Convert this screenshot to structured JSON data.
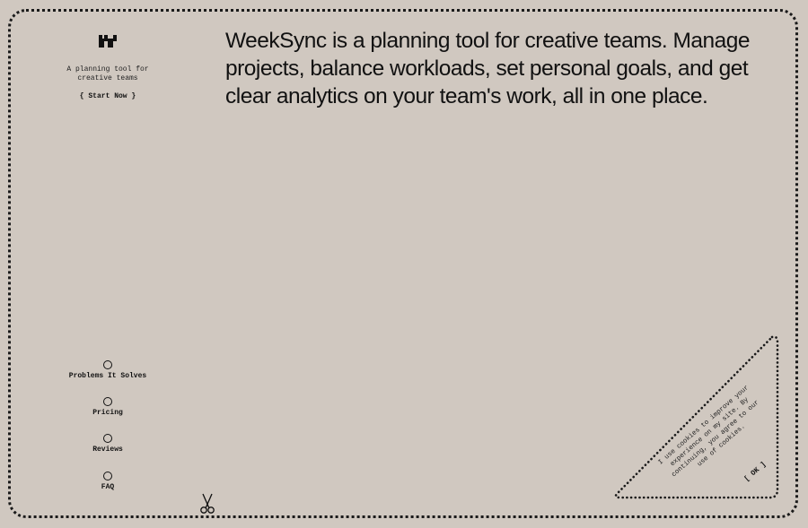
{
  "brand": {
    "logo_icon": "weeksync-logo-icon",
    "tagline": "A planning tool for creative teams",
    "start_button": "{ Start Now }"
  },
  "hero": {
    "headline": "WeekSync is a planning tool for creative teams. Manage projects, balance workloads, set personal goals, and get clear analytics on your team's work, all in one place."
  },
  "nav": {
    "items": [
      {
        "label": "Problems It Solves",
        "icon": "circle-icon"
      },
      {
        "label": "Pricing",
        "icon": "circle-icon"
      },
      {
        "label": "Reviews",
        "icon": "circle-icon"
      },
      {
        "label": "FAQ",
        "icon": "circle-icon"
      }
    ]
  },
  "decor": {
    "scissors_icon": "scissors-icon"
  },
  "cookie": {
    "text": "I use cookies to improve your experience on my site. By continuing, you agree to our use of cookies.",
    "ok_label": "[ OK ]"
  },
  "colors": {
    "background": "#d0c8c0",
    "ink": "#111111"
  }
}
